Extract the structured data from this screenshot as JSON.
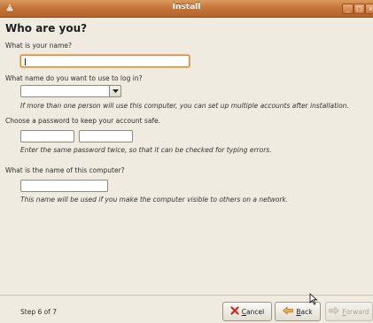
{
  "window": {
    "title": "Install",
    "minimize_glyph": "_",
    "maximize_glyph": "□",
    "close_glyph": "x"
  },
  "page": {
    "heading": "Who are you?",
    "name_label": "What is your name?",
    "name_value": "",
    "login_label": "What name do you want to use to log in?",
    "login_value": "",
    "login_hint": "If more than one person will use this computer, you can set up multiple accounts after installation.",
    "password_label": "Choose a password to keep your account safe.",
    "password_value": "",
    "password_confirm_value": "",
    "password_hint": "Enter the same password twice, so that it can be checked for typing errors.",
    "computer_label": "What is the name of this computer?",
    "computer_value": "",
    "computer_hint": "This name will be used if you make the computer visible to others on a network."
  },
  "footer": {
    "step": "Step 6 of 7",
    "cancel_mnemonic": "C",
    "cancel_rest": "ancel",
    "back_mnemonic": "B",
    "back_rest": "ack",
    "forward_mnemonic": "F",
    "forward_rest": "orward"
  },
  "colors": {
    "titlebar": "#c7773b",
    "background": "#efebe0",
    "focus": "#e0862a"
  },
  "icons": {
    "app": "installer-icon",
    "combo": "chevron-down-icon",
    "cancel": "cancel-icon",
    "back": "arrow-left-icon",
    "forward": "arrow-right-icon",
    "pointer": "mouse-pointer-icon"
  }
}
